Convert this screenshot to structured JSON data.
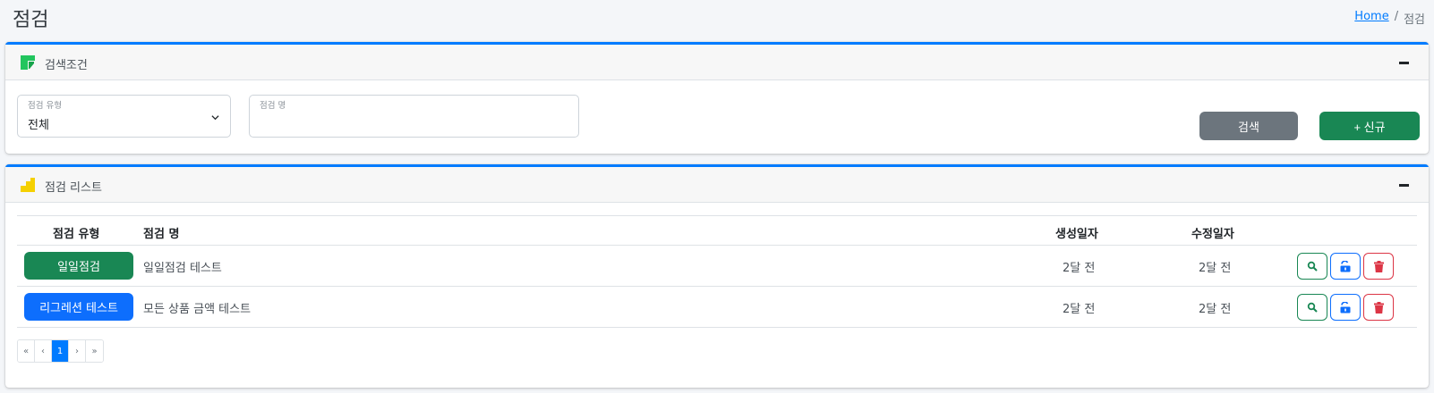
{
  "page": {
    "title": "점검"
  },
  "breadcrumb": {
    "home": "Home",
    "separator": "/",
    "current": "점검"
  },
  "search": {
    "title": "검색조건",
    "icon": "form-icon",
    "type_label": "점검 유형",
    "type_value": "전체",
    "name_label": "점검 명",
    "name_value": "",
    "search_button": "검색",
    "new_button": "+ 신규",
    "colors": {
      "search_button": "#6c757d",
      "new_button": "#198754",
      "icon": "#22c55e"
    }
  },
  "list": {
    "title": "점검 리스트",
    "icon": "stairs-icon",
    "columns": {
      "type": "점검 유형",
      "name": "점검 명",
      "created": "생성일자",
      "updated": "수정일자"
    },
    "rows": [
      {
        "type": "일일점검",
        "type_color": "#198754",
        "name": "일일점검 테스트",
        "created": "2달 전",
        "updated": "2달 전"
      },
      {
        "type": "리그레션 테스트",
        "type_color": "#0d6efd",
        "name": "모든 상품 금액 테스트",
        "created": "2달 전",
        "updated": "2달 전"
      }
    ],
    "actions": {
      "view": "search-icon",
      "unlock": "unlock-icon",
      "delete": "trash-icon"
    },
    "pagination": {
      "first": "«",
      "prev": "‹",
      "current": "1",
      "next": "›",
      "last": "»"
    }
  }
}
